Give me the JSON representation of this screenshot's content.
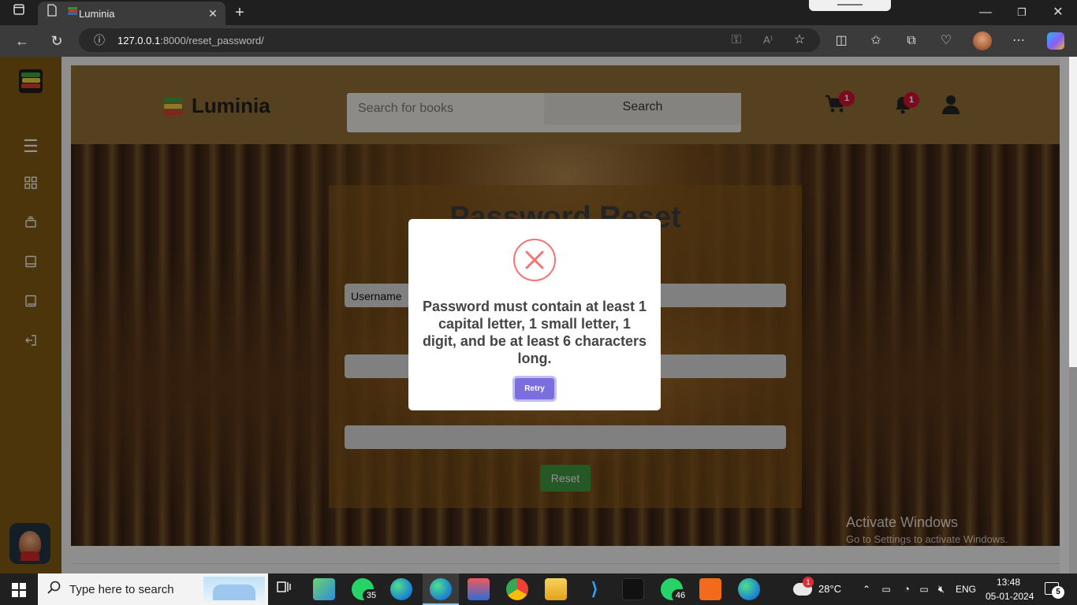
{
  "browser": {
    "tab_title": "Luminia",
    "url_host": "127.0.0.1",
    "url_rest": ":8000/reset_password/"
  },
  "header": {
    "brand": "Luminia",
    "search_placeholder": "Search for books",
    "search_button": "Search",
    "cart_badge": "1",
    "notif_badge": "1"
  },
  "form": {
    "title": "Password Reset",
    "username_label": "Username",
    "reset_button": "Reset"
  },
  "modal": {
    "message": "Password must contain at least 1 capital letter, 1 small letter, 1 digit, and be at least 6 characters long.",
    "retry_button": "Retry"
  },
  "watermark": {
    "line1": "Activate Windows",
    "line2": "Go to Settings to activate Windows."
  },
  "taskbar": {
    "search_placeholder": "Type here to search",
    "whatsapp_badge_1": "35",
    "whatsapp_badge_2": "46",
    "weather_temp": "28°C",
    "weather_badge": "1",
    "language": "ENG",
    "time": "13:48",
    "date": "05-01-2024",
    "notif_count": "5"
  },
  "colors": {
    "sidebar": "#7c5612",
    "header": "#8a6833",
    "retry": "#7b6fe0",
    "reset": "#3e8e3e",
    "error": "#f27474",
    "badge": "#c8102e"
  }
}
